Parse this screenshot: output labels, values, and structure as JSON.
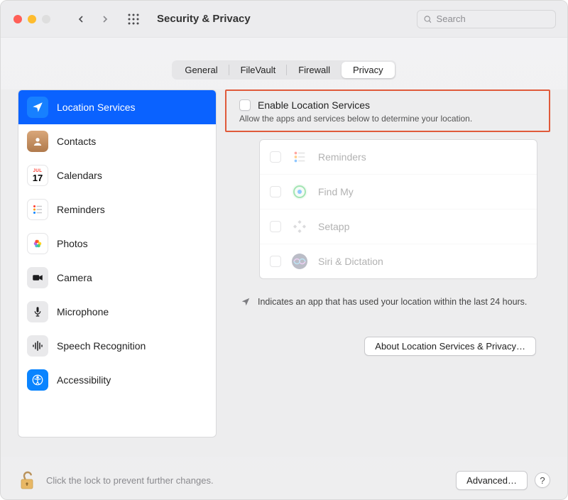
{
  "window": {
    "title": "Security & Privacy"
  },
  "search": {
    "placeholder": "Search"
  },
  "tabs": {
    "general": "General",
    "filevault": "FileVault",
    "firewall": "Firewall",
    "privacy": "Privacy"
  },
  "sidebar": {
    "items": [
      {
        "label": "Location Services"
      },
      {
        "label": "Contacts"
      },
      {
        "label": "Calendars"
      },
      {
        "label": "Reminders"
      },
      {
        "label": "Photos"
      },
      {
        "label": "Camera"
      },
      {
        "label": "Microphone"
      },
      {
        "label": "Speech Recognition"
      },
      {
        "label": "Accessibility"
      }
    ]
  },
  "enable": {
    "title": "Enable Location Services",
    "subtitle": "Allow the apps and services below to determine your location."
  },
  "apps": [
    {
      "label": "Reminders"
    },
    {
      "label": "Find My"
    },
    {
      "label": "Setapp"
    },
    {
      "label": "Siri & Dictation"
    }
  ],
  "explain": {
    "text": "Indicates an app that has used your location within the last 24 hours."
  },
  "buttons": {
    "about": "About Location Services & Privacy…",
    "advanced": "Advanced…",
    "help": "?"
  },
  "lock": {
    "text": "Click the lock to prevent further changes."
  },
  "calendar_day": "17"
}
